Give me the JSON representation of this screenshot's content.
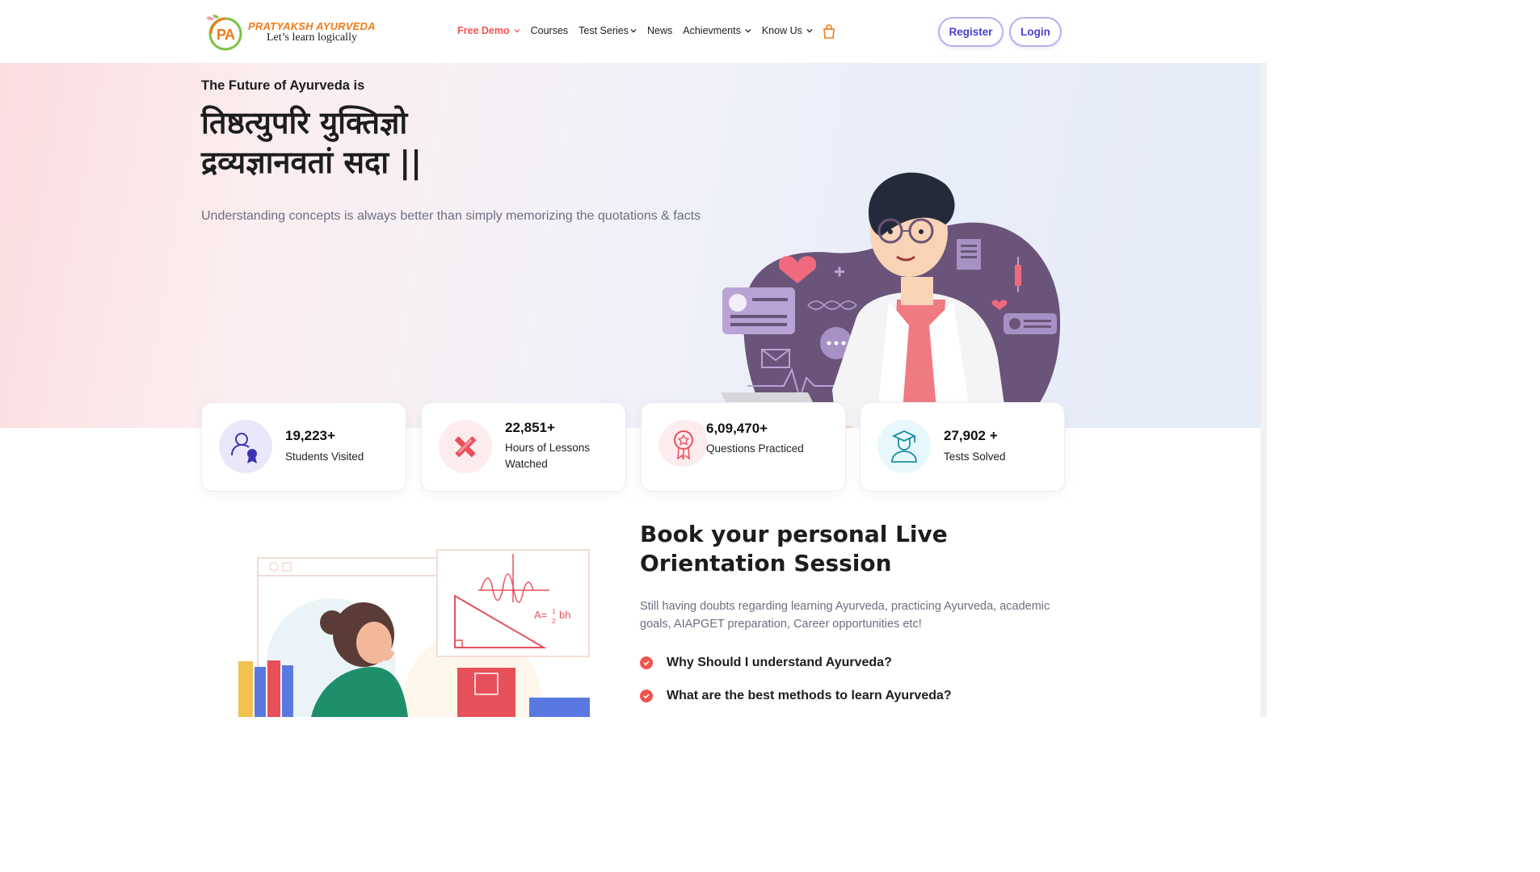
{
  "brand": {
    "name": "PRATYAKSH AYURVEDA",
    "tagline": "Let’s learn logically"
  },
  "nav": {
    "items": [
      {
        "label": "Free Demo",
        "dropdown": true,
        "active": true
      },
      {
        "label": "Courses",
        "dropdown": false
      },
      {
        "label": "Test Series",
        "dropdown": true
      },
      {
        "label": "News",
        "dropdown": false
      },
      {
        "label": "Achievments",
        "dropdown": true
      },
      {
        "label": "Know Us",
        "dropdown": true
      }
    ],
    "cart_icon": "shopping-bag-icon",
    "register_label": "Register",
    "login_label": "Login"
  },
  "hero": {
    "subtitle": "The Future of Ayurveda is",
    "title_line1": "तिष्ठत्युपरि युक्तिज्ञो",
    "title_line2": "द्रव्यज्ञानवतां सदा ||",
    "description": "Understanding concepts is always better than simply memorizing the quotations & facts"
  },
  "stats": [
    {
      "value": "19,223+",
      "label": "Students Visited",
      "icon": "student-award-icon"
    },
    {
      "value": "22,851+",
      "label": "Hours of Lessons Watched",
      "icon": "pencil-ruler-icon"
    },
    {
      "value": "6,09,470+",
      "label": "Questions Practiced",
      "icon": "award-badge-icon"
    },
    {
      "value": "27,902 +",
      "label": "Tests Solved",
      "icon": "graduate-icon"
    }
  ],
  "orientation": {
    "title": "Book your personal Live Orientation Session",
    "description": "Still having doubts regarding learning Ayurveda, practicing Ayurveda, academic goals, AIAPGET preparation, Career opportunities etc!",
    "questions": [
      "Why Should I understand Ayurveda?",
      "What are the best methods to learn Ayurveda?"
    ]
  },
  "colors": {
    "accent": "#f0544f",
    "primary": "#4a3fcf",
    "brand_orange": "#f07a1a"
  }
}
